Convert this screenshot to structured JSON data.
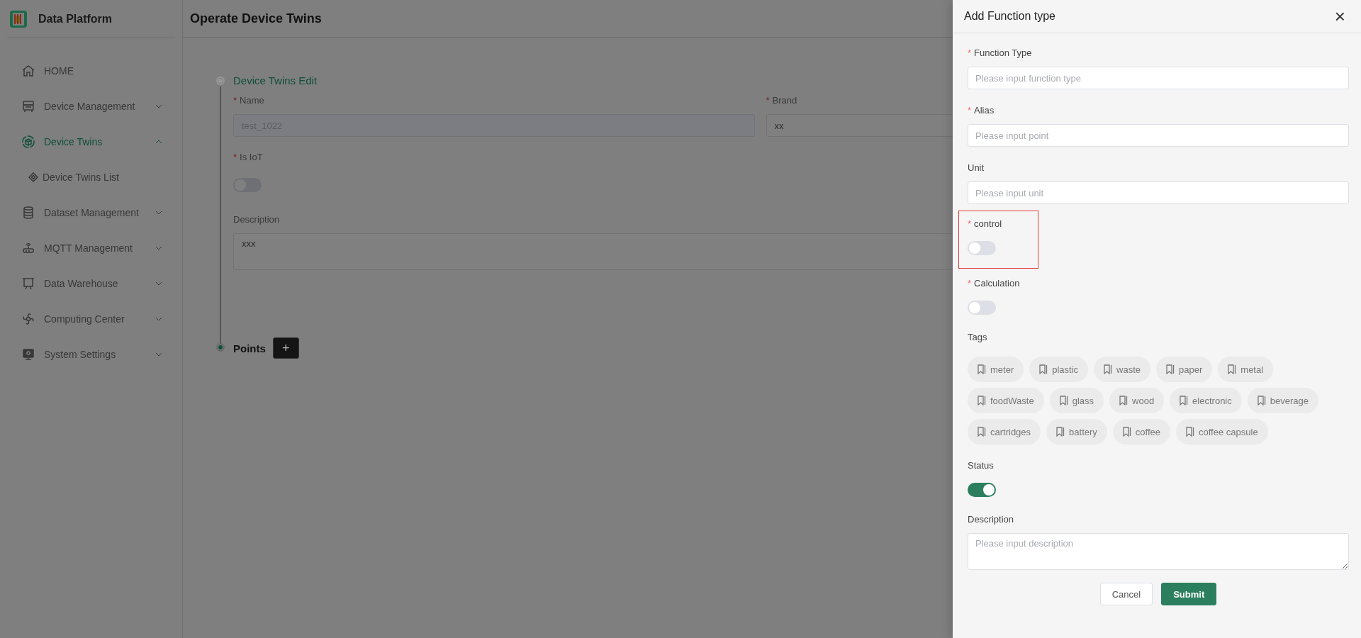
{
  "sidebar": {
    "brand": "Data Platform",
    "items": [
      {
        "label": "HOME",
        "kind": "link",
        "selected": false
      },
      {
        "label": "Device Management",
        "kind": "menu",
        "expanded": false,
        "selected": false
      },
      {
        "label": "Device Twins",
        "kind": "menu",
        "expanded": true,
        "selected": true,
        "children": [
          {
            "label": "Device Twins List",
            "selected": false
          }
        ]
      },
      {
        "label": "Dataset Management",
        "kind": "menu",
        "expanded": false,
        "selected": false
      },
      {
        "label": "MQTT Management",
        "kind": "menu",
        "expanded": false,
        "selected": false
      },
      {
        "label": "Data Warehouse",
        "kind": "menu",
        "expanded": false,
        "selected": false
      },
      {
        "label": "Computing Center",
        "kind": "menu",
        "expanded": false,
        "selected": false
      },
      {
        "label": "System Settings",
        "kind": "menu",
        "expanded": false,
        "selected": false
      }
    ]
  },
  "main": {
    "title": "Operate Device Twins",
    "steps": [
      {
        "title": "Device Twins Edit",
        "kind": "section",
        "active": false
      },
      {
        "title": "Points",
        "kind": "add",
        "active": true,
        "button": "+"
      }
    ],
    "fields": [
      {
        "kind": "input",
        "label": "Name",
        "required_mark": "*",
        "value": "test_1022",
        "disabled": true
      },
      {
        "kind": "input",
        "label": "Brand",
        "required_mark": "*",
        "value": "xx",
        "disabled": false
      },
      {
        "kind": "switch",
        "label": "Is IoT",
        "required_mark": "*",
        "on": false
      },
      {
        "kind": "textarea",
        "label": "Description",
        "value": "xxx"
      }
    ]
  },
  "drawer": {
    "title": "Add Function type",
    "close": "×",
    "fields": [
      {
        "kind": "input",
        "label": "Function Type",
        "required_mark": "*",
        "placeholder": "Please input function type",
        "highlighted": false
      },
      {
        "kind": "input",
        "label": "Alias",
        "required_mark": "*",
        "placeholder": "Please input point",
        "highlighted": false
      },
      {
        "kind": "input",
        "label": "Unit",
        "placeholder": "Please input unit",
        "highlighted": false
      },
      {
        "kind": "switch",
        "label": "control",
        "required_mark": "*",
        "on": false,
        "highlighted": true
      },
      {
        "kind": "switch",
        "label": "Calculation",
        "required_mark": "*",
        "on": false,
        "highlighted": false
      },
      {
        "kind": "tags",
        "label": "Tags",
        "highlighted": false,
        "tags": [
          "meter",
          "plastic",
          "waste",
          "paper",
          "metal",
          "foodWaste",
          "glass",
          "wood",
          "electronic",
          "beverage",
          "cartridges",
          "battery",
          "coffee",
          "coffee capsule"
        ]
      },
      {
        "kind": "switch",
        "label": "Status",
        "on": true,
        "highlighted": false
      },
      {
        "kind": "textarea",
        "label": "Description",
        "placeholder": "Please input description",
        "highlighted": false
      }
    ],
    "buttons": [
      {
        "label": "Cancel",
        "kind": "default"
      },
      {
        "label": "Submit",
        "kind": "primary"
      }
    ]
  }
}
